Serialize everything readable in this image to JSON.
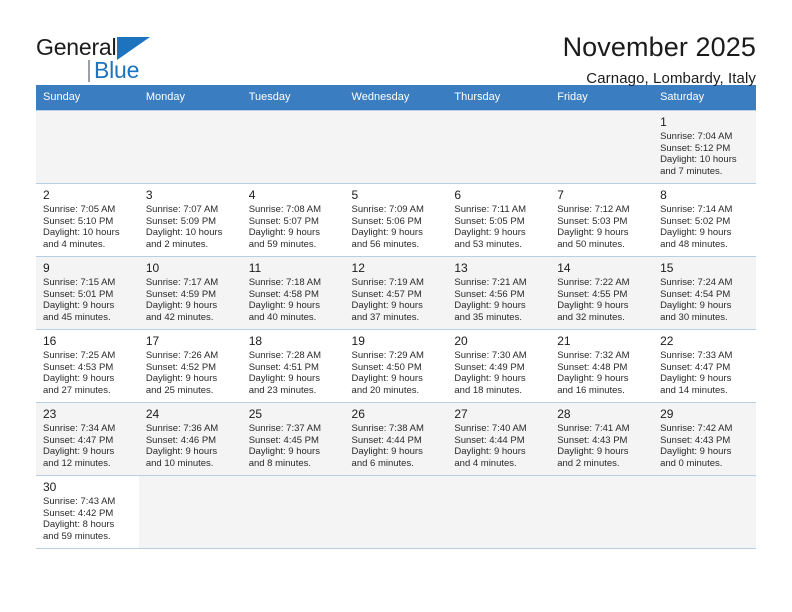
{
  "brand": {
    "name_part1": "General",
    "name_part2": "Blue",
    "accent_color": "#1e73be"
  },
  "header": {
    "title": "November 2025",
    "subtitle": "Carnago, Lombardy, Italy"
  },
  "calendar": {
    "header_bg": "#3a7dc0",
    "weekday_headers": [
      "Sunday",
      "Monday",
      "Tuesday",
      "Wednesday",
      "Thursday",
      "Friday",
      "Saturday"
    ],
    "labels": {
      "sunrise": "Sunrise:",
      "sunset": "Sunset:",
      "daylight": "Daylight:"
    },
    "weeks": [
      [
        {
          "day": ""
        },
        {
          "day": ""
        },
        {
          "day": ""
        },
        {
          "day": ""
        },
        {
          "day": ""
        },
        {
          "day": ""
        },
        {
          "day": "1",
          "sunrise": "Sunrise: 7:04 AM",
          "sunset": "Sunset: 5:12 PM",
          "daylight_line1": "Daylight: 10 hours",
          "daylight_line2": "and 7 minutes."
        }
      ],
      [
        {
          "day": "2",
          "sunrise": "Sunrise: 7:05 AM",
          "sunset": "Sunset: 5:10 PM",
          "daylight_line1": "Daylight: 10 hours",
          "daylight_line2": "and 4 minutes."
        },
        {
          "day": "3",
          "sunrise": "Sunrise: 7:07 AM",
          "sunset": "Sunset: 5:09 PM",
          "daylight_line1": "Daylight: 10 hours",
          "daylight_line2": "and 2 minutes."
        },
        {
          "day": "4",
          "sunrise": "Sunrise: 7:08 AM",
          "sunset": "Sunset: 5:07 PM",
          "daylight_line1": "Daylight: 9 hours",
          "daylight_line2": "and 59 minutes."
        },
        {
          "day": "5",
          "sunrise": "Sunrise: 7:09 AM",
          "sunset": "Sunset: 5:06 PM",
          "daylight_line1": "Daylight: 9 hours",
          "daylight_line2": "and 56 minutes."
        },
        {
          "day": "6",
          "sunrise": "Sunrise: 7:11 AM",
          "sunset": "Sunset: 5:05 PM",
          "daylight_line1": "Daylight: 9 hours",
          "daylight_line2": "and 53 minutes."
        },
        {
          "day": "7",
          "sunrise": "Sunrise: 7:12 AM",
          "sunset": "Sunset: 5:03 PM",
          "daylight_line1": "Daylight: 9 hours",
          "daylight_line2": "and 50 minutes."
        },
        {
          "day": "8",
          "sunrise": "Sunrise: 7:14 AM",
          "sunset": "Sunset: 5:02 PM",
          "daylight_line1": "Daylight: 9 hours",
          "daylight_line2": "and 48 minutes."
        }
      ],
      [
        {
          "day": "9",
          "sunrise": "Sunrise: 7:15 AM",
          "sunset": "Sunset: 5:01 PM",
          "daylight_line1": "Daylight: 9 hours",
          "daylight_line2": "and 45 minutes."
        },
        {
          "day": "10",
          "sunrise": "Sunrise: 7:17 AM",
          "sunset": "Sunset: 4:59 PM",
          "daylight_line1": "Daylight: 9 hours",
          "daylight_line2": "and 42 minutes."
        },
        {
          "day": "11",
          "sunrise": "Sunrise: 7:18 AM",
          "sunset": "Sunset: 4:58 PM",
          "daylight_line1": "Daylight: 9 hours",
          "daylight_line2": "and 40 minutes."
        },
        {
          "day": "12",
          "sunrise": "Sunrise: 7:19 AM",
          "sunset": "Sunset: 4:57 PM",
          "daylight_line1": "Daylight: 9 hours",
          "daylight_line2": "and 37 minutes."
        },
        {
          "day": "13",
          "sunrise": "Sunrise: 7:21 AM",
          "sunset": "Sunset: 4:56 PM",
          "daylight_line1": "Daylight: 9 hours",
          "daylight_line2": "and 35 minutes."
        },
        {
          "day": "14",
          "sunrise": "Sunrise: 7:22 AM",
          "sunset": "Sunset: 4:55 PM",
          "daylight_line1": "Daylight: 9 hours",
          "daylight_line2": "and 32 minutes."
        },
        {
          "day": "15",
          "sunrise": "Sunrise: 7:24 AM",
          "sunset": "Sunset: 4:54 PM",
          "daylight_line1": "Daylight: 9 hours",
          "daylight_line2": "and 30 minutes."
        }
      ],
      [
        {
          "day": "16",
          "sunrise": "Sunrise: 7:25 AM",
          "sunset": "Sunset: 4:53 PM",
          "daylight_line1": "Daylight: 9 hours",
          "daylight_line2": "and 27 minutes."
        },
        {
          "day": "17",
          "sunrise": "Sunrise: 7:26 AM",
          "sunset": "Sunset: 4:52 PM",
          "daylight_line1": "Daylight: 9 hours",
          "daylight_line2": "and 25 minutes."
        },
        {
          "day": "18",
          "sunrise": "Sunrise: 7:28 AM",
          "sunset": "Sunset: 4:51 PM",
          "daylight_line1": "Daylight: 9 hours",
          "daylight_line2": "and 23 minutes."
        },
        {
          "day": "19",
          "sunrise": "Sunrise: 7:29 AM",
          "sunset": "Sunset: 4:50 PM",
          "daylight_line1": "Daylight: 9 hours",
          "daylight_line2": "and 20 minutes."
        },
        {
          "day": "20",
          "sunrise": "Sunrise: 7:30 AM",
          "sunset": "Sunset: 4:49 PM",
          "daylight_line1": "Daylight: 9 hours",
          "daylight_line2": "and 18 minutes."
        },
        {
          "day": "21",
          "sunrise": "Sunrise: 7:32 AM",
          "sunset": "Sunset: 4:48 PM",
          "daylight_line1": "Daylight: 9 hours",
          "daylight_line2": "and 16 minutes."
        },
        {
          "day": "22",
          "sunrise": "Sunrise: 7:33 AM",
          "sunset": "Sunset: 4:47 PM",
          "daylight_line1": "Daylight: 9 hours",
          "daylight_line2": "and 14 minutes."
        }
      ],
      [
        {
          "day": "23",
          "sunrise": "Sunrise: 7:34 AM",
          "sunset": "Sunset: 4:47 PM",
          "daylight_line1": "Daylight: 9 hours",
          "daylight_line2": "and 12 minutes."
        },
        {
          "day": "24",
          "sunrise": "Sunrise: 7:36 AM",
          "sunset": "Sunset: 4:46 PM",
          "daylight_line1": "Daylight: 9 hours",
          "daylight_line2": "and 10 minutes."
        },
        {
          "day": "25",
          "sunrise": "Sunrise: 7:37 AM",
          "sunset": "Sunset: 4:45 PM",
          "daylight_line1": "Daylight: 9 hours",
          "daylight_line2": "and 8 minutes."
        },
        {
          "day": "26",
          "sunrise": "Sunrise: 7:38 AM",
          "sunset": "Sunset: 4:44 PM",
          "daylight_line1": "Daylight: 9 hours",
          "daylight_line2": "and 6 minutes."
        },
        {
          "day": "27",
          "sunrise": "Sunrise: 7:40 AM",
          "sunset": "Sunset: 4:44 PM",
          "daylight_line1": "Daylight: 9 hours",
          "daylight_line2": "and 4 minutes."
        },
        {
          "day": "28",
          "sunrise": "Sunrise: 7:41 AM",
          "sunset": "Sunset: 4:43 PM",
          "daylight_line1": "Daylight: 9 hours",
          "daylight_line2": "and 2 minutes."
        },
        {
          "day": "29",
          "sunrise": "Sunrise: 7:42 AM",
          "sunset": "Sunset: 4:43 PM",
          "daylight_line1": "Daylight: 9 hours",
          "daylight_line2": "and 0 minutes."
        }
      ],
      [
        {
          "day": "30",
          "sunrise": "Sunrise: 7:43 AM",
          "sunset": "Sunset: 4:42 PM",
          "daylight_line1": "Daylight: 8 hours",
          "daylight_line2": "and 59 minutes."
        },
        {
          "day": ""
        },
        {
          "day": ""
        },
        {
          "day": ""
        },
        {
          "day": ""
        },
        {
          "day": ""
        },
        {
          "day": ""
        }
      ]
    ]
  }
}
